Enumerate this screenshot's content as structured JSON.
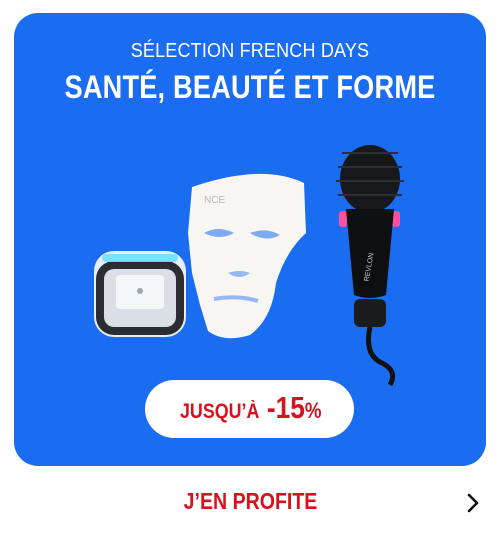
{
  "banner": {
    "kicker": "SÉLECTION FRENCH DAYS",
    "title": "SANTÉ, BEAUTÉ ET FORME",
    "background_color": "#1a6cf0",
    "products": [
      {
        "name": "facial-device",
        "icon": "facial-device-icon"
      },
      {
        "name": "led-face-mask",
        "icon": "led-mask-icon",
        "brand_text": "NCE"
      },
      {
        "name": "hair-dryer-brush",
        "icon": "hair-brush-icon",
        "brand_text": "REVLON"
      }
    ],
    "promo": {
      "prefix": "JUSQU’À",
      "value": "-15",
      "unit": "%",
      "text_color": "#d5121e"
    }
  },
  "cta": {
    "label": "J’EN PROFITE",
    "arrow_icon": "chevron-right-icon"
  }
}
